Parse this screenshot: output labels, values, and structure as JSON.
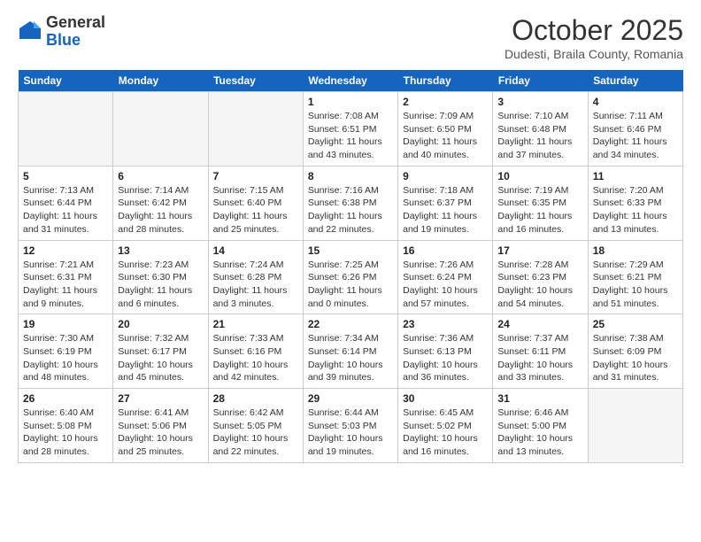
{
  "header": {
    "logo_general": "General",
    "logo_blue": "Blue",
    "month": "October 2025",
    "location": "Dudesti, Braila County, Romania"
  },
  "days_of_week": [
    "Sunday",
    "Monday",
    "Tuesday",
    "Wednesday",
    "Thursday",
    "Friday",
    "Saturday"
  ],
  "weeks": [
    [
      {
        "day": "",
        "empty": true
      },
      {
        "day": "",
        "empty": true
      },
      {
        "day": "",
        "empty": true
      },
      {
        "day": "1",
        "line1": "Sunrise: 7:08 AM",
        "line2": "Sunset: 6:51 PM",
        "line3": "Daylight: 11 hours",
        "line4": "and 43 minutes."
      },
      {
        "day": "2",
        "line1": "Sunrise: 7:09 AM",
        "line2": "Sunset: 6:50 PM",
        "line3": "Daylight: 11 hours",
        "line4": "and 40 minutes."
      },
      {
        "day": "3",
        "line1": "Sunrise: 7:10 AM",
        "line2": "Sunset: 6:48 PM",
        "line3": "Daylight: 11 hours",
        "line4": "and 37 minutes."
      },
      {
        "day": "4",
        "line1": "Sunrise: 7:11 AM",
        "line2": "Sunset: 6:46 PM",
        "line3": "Daylight: 11 hours",
        "line4": "and 34 minutes."
      }
    ],
    [
      {
        "day": "5",
        "line1": "Sunrise: 7:13 AM",
        "line2": "Sunset: 6:44 PM",
        "line3": "Daylight: 11 hours",
        "line4": "and 31 minutes."
      },
      {
        "day": "6",
        "line1": "Sunrise: 7:14 AM",
        "line2": "Sunset: 6:42 PM",
        "line3": "Daylight: 11 hours",
        "line4": "and 28 minutes."
      },
      {
        "day": "7",
        "line1": "Sunrise: 7:15 AM",
        "line2": "Sunset: 6:40 PM",
        "line3": "Daylight: 11 hours",
        "line4": "and 25 minutes."
      },
      {
        "day": "8",
        "line1": "Sunrise: 7:16 AM",
        "line2": "Sunset: 6:38 PM",
        "line3": "Daylight: 11 hours",
        "line4": "and 22 minutes."
      },
      {
        "day": "9",
        "line1": "Sunrise: 7:18 AM",
        "line2": "Sunset: 6:37 PM",
        "line3": "Daylight: 11 hours",
        "line4": "and 19 minutes."
      },
      {
        "day": "10",
        "line1": "Sunrise: 7:19 AM",
        "line2": "Sunset: 6:35 PM",
        "line3": "Daylight: 11 hours",
        "line4": "and 16 minutes."
      },
      {
        "day": "11",
        "line1": "Sunrise: 7:20 AM",
        "line2": "Sunset: 6:33 PM",
        "line3": "Daylight: 11 hours",
        "line4": "and 13 minutes."
      }
    ],
    [
      {
        "day": "12",
        "line1": "Sunrise: 7:21 AM",
        "line2": "Sunset: 6:31 PM",
        "line3": "Daylight: 11 hours",
        "line4": "and 9 minutes."
      },
      {
        "day": "13",
        "line1": "Sunrise: 7:23 AM",
        "line2": "Sunset: 6:30 PM",
        "line3": "Daylight: 11 hours",
        "line4": "and 6 minutes."
      },
      {
        "day": "14",
        "line1": "Sunrise: 7:24 AM",
        "line2": "Sunset: 6:28 PM",
        "line3": "Daylight: 11 hours",
        "line4": "and 3 minutes."
      },
      {
        "day": "15",
        "line1": "Sunrise: 7:25 AM",
        "line2": "Sunset: 6:26 PM",
        "line3": "Daylight: 11 hours",
        "line4": "and 0 minutes."
      },
      {
        "day": "16",
        "line1": "Sunrise: 7:26 AM",
        "line2": "Sunset: 6:24 PM",
        "line3": "Daylight: 10 hours",
        "line4": "and 57 minutes."
      },
      {
        "day": "17",
        "line1": "Sunrise: 7:28 AM",
        "line2": "Sunset: 6:23 PM",
        "line3": "Daylight: 10 hours",
        "line4": "and 54 minutes."
      },
      {
        "day": "18",
        "line1": "Sunrise: 7:29 AM",
        "line2": "Sunset: 6:21 PM",
        "line3": "Daylight: 10 hours",
        "line4": "and 51 minutes."
      }
    ],
    [
      {
        "day": "19",
        "line1": "Sunrise: 7:30 AM",
        "line2": "Sunset: 6:19 PM",
        "line3": "Daylight: 10 hours",
        "line4": "and 48 minutes."
      },
      {
        "day": "20",
        "line1": "Sunrise: 7:32 AM",
        "line2": "Sunset: 6:17 PM",
        "line3": "Daylight: 10 hours",
        "line4": "and 45 minutes."
      },
      {
        "day": "21",
        "line1": "Sunrise: 7:33 AM",
        "line2": "Sunset: 6:16 PM",
        "line3": "Daylight: 10 hours",
        "line4": "and 42 minutes."
      },
      {
        "day": "22",
        "line1": "Sunrise: 7:34 AM",
        "line2": "Sunset: 6:14 PM",
        "line3": "Daylight: 10 hours",
        "line4": "and 39 minutes."
      },
      {
        "day": "23",
        "line1": "Sunrise: 7:36 AM",
        "line2": "Sunset: 6:13 PM",
        "line3": "Daylight: 10 hours",
        "line4": "and 36 minutes."
      },
      {
        "day": "24",
        "line1": "Sunrise: 7:37 AM",
        "line2": "Sunset: 6:11 PM",
        "line3": "Daylight: 10 hours",
        "line4": "and 33 minutes."
      },
      {
        "day": "25",
        "line1": "Sunrise: 7:38 AM",
        "line2": "Sunset: 6:09 PM",
        "line3": "Daylight: 10 hours",
        "line4": "and 31 minutes."
      }
    ],
    [
      {
        "day": "26",
        "line1": "Sunrise: 6:40 AM",
        "line2": "Sunset: 5:08 PM",
        "line3": "Daylight: 10 hours",
        "line4": "and 28 minutes."
      },
      {
        "day": "27",
        "line1": "Sunrise: 6:41 AM",
        "line2": "Sunset: 5:06 PM",
        "line3": "Daylight: 10 hours",
        "line4": "and 25 minutes."
      },
      {
        "day": "28",
        "line1": "Sunrise: 6:42 AM",
        "line2": "Sunset: 5:05 PM",
        "line3": "Daylight: 10 hours",
        "line4": "and 22 minutes."
      },
      {
        "day": "29",
        "line1": "Sunrise: 6:44 AM",
        "line2": "Sunset: 5:03 PM",
        "line3": "Daylight: 10 hours",
        "line4": "and 19 minutes."
      },
      {
        "day": "30",
        "line1": "Sunrise: 6:45 AM",
        "line2": "Sunset: 5:02 PM",
        "line3": "Daylight: 10 hours",
        "line4": "and 16 minutes."
      },
      {
        "day": "31",
        "line1": "Sunrise: 6:46 AM",
        "line2": "Sunset: 5:00 PM",
        "line3": "Daylight: 10 hours",
        "line4": "and 13 minutes."
      },
      {
        "day": "",
        "empty": true
      }
    ]
  ]
}
